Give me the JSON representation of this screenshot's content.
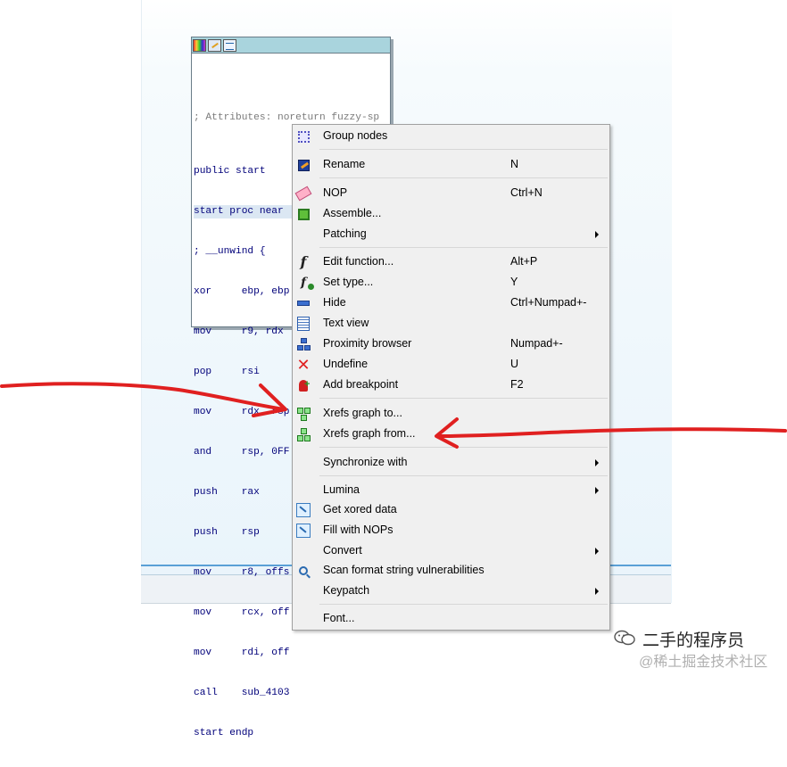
{
  "code_node": {
    "comment": "; Attributes: noreturn fuzzy-sp",
    "lines": [
      "public start",
      "start proc near",
      "; __unwind {",
      "xor     ebp, ebp",
      "mov     r9, rdx",
      "pop     rsi",
      "mov     rdx, rsp",
      "and     rsp, 0FF",
      "push    rax",
      "push    rsp",
      "mov     r8, offs",
      "mov     rcx, off",
      "mov     rdi, off",
      "call    sub_4103",
      "start endp"
    ]
  },
  "context_menu": {
    "items": [
      {
        "label": "Group nodes",
        "shortcut": "",
        "icon": "group-nodes-icon"
      },
      {
        "label": "Rename",
        "shortcut": "N",
        "icon": "rename-icon"
      },
      {
        "label": "NOP",
        "shortcut": "Ctrl+N",
        "icon": "nop-icon"
      },
      {
        "label": "Assemble...",
        "shortcut": "",
        "icon": "assemble-icon"
      },
      {
        "label": "Patching",
        "shortcut": "",
        "icon": "",
        "submenu": true
      },
      {
        "label": "Edit function...",
        "shortcut": "Alt+P",
        "icon": "function-icon"
      },
      {
        "label": "Set type...",
        "shortcut": "Y",
        "icon": "set-type-icon"
      },
      {
        "label": "Hide",
        "shortcut": "Ctrl+Numpad+-",
        "icon": "hide-icon"
      },
      {
        "label": "Text view",
        "shortcut": "",
        "icon": "text-view-icon"
      },
      {
        "label": "Proximity browser",
        "shortcut": "Numpad+-",
        "icon": "proximity-browser-icon"
      },
      {
        "label": "Undefine",
        "shortcut": "U",
        "icon": "undefine-icon"
      },
      {
        "label": "Add breakpoint",
        "shortcut": "F2",
        "icon": "breakpoint-icon"
      },
      {
        "label": "Xrefs graph to...",
        "shortcut": "",
        "icon": "xrefs-to-icon"
      },
      {
        "label": "Xrefs graph from...",
        "shortcut": "",
        "icon": "xrefs-from-icon"
      },
      {
        "label": "Synchronize with",
        "shortcut": "",
        "icon": "",
        "submenu": true
      },
      {
        "label": "Lumina",
        "shortcut": "",
        "icon": "",
        "submenu": true
      },
      {
        "label": "Get xored data",
        "shortcut": "",
        "icon": "xored-data-icon"
      },
      {
        "label": "Fill with NOPs",
        "shortcut": "",
        "icon": "fill-nops-icon"
      },
      {
        "label": "Convert",
        "shortcut": "",
        "icon": "",
        "submenu": true
      },
      {
        "label": "Scan format string vulnerabilities",
        "shortcut": "",
        "icon": "scan-icon"
      },
      {
        "label": "Keypatch",
        "shortcut": "",
        "icon": "",
        "submenu": true
      },
      {
        "label": "Font...",
        "shortcut": "",
        "icon": ""
      }
    ]
  },
  "annotation": {
    "arrow_color": "#e02020"
  },
  "watermark": {
    "line1": "二手的程序员",
    "line2": "@稀土掘金技术社区"
  }
}
